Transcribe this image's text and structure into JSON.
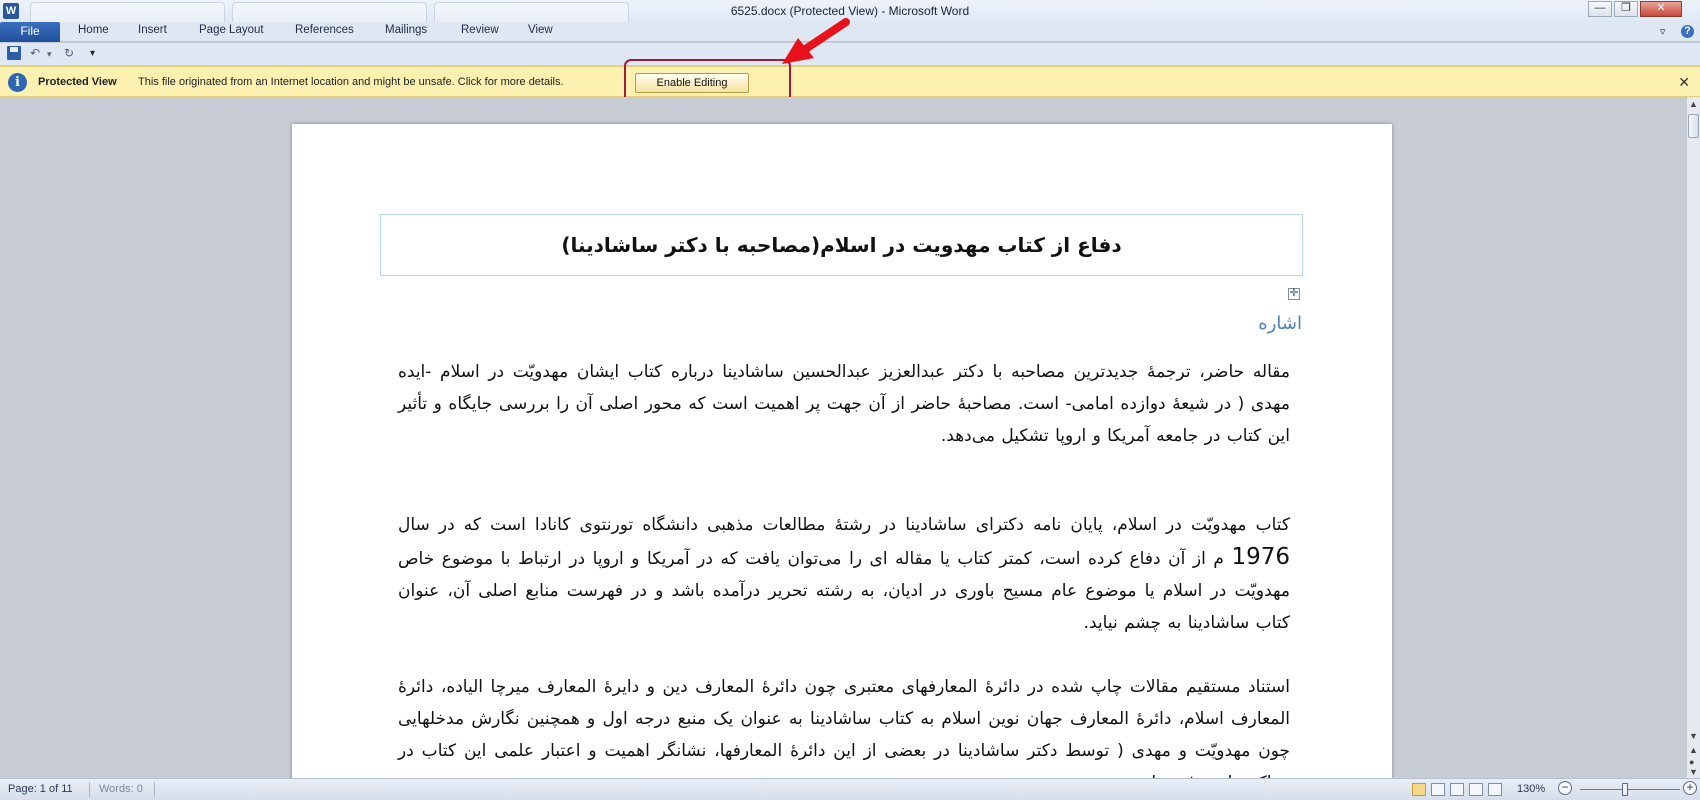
{
  "titlebar": {
    "title": "6525.docx (Protected View)  -  Microsoft Word",
    "app_icon_text": "W",
    "minimize": "—",
    "restore": "❐",
    "close": "✕"
  },
  "ribbon": {
    "file": "File",
    "tabs": [
      "Home",
      "Insert",
      "Page Layout",
      "References",
      "Mailings",
      "Review",
      "View"
    ],
    "minimize_ribbon": "▿",
    "help": "?"
  },
  "qat": {
    "undo": "↶",
    "undo_dropdown": "▾",
    "redo": "↻",
    "customize": "▾"
  },
  "protected_view": {
    "title": "Protected View",
    "message": "This file originated from an Internet location and might be unsafe. Click for more details.",
    "enable_button": "Enable Editing",
    "close": "✕",
    "icon": "i"
  },
  "document": {
    "title": "دفاع از کتاب مهدویت در اسلام(مصاحبه با دکتر ساشادینا)",
    "heading": "اشاره",
    "table_handle": "✛",
    "paragraphs": [
      {
        "before": "مقاله حاضر، ترجمهٔ جدیدترین مصاحبه با دکتر عبدالعزیز عبدالحسین ساشادینا درباره کتاب ایشان مهدویّت در اسلام -ایده مهدی ( در شیعهٔ دوازده امامی- است. مصاحبهٔ حاضر از آن جهت پر اهمیت است که محور اصلی آن را بررسی جایگاه و تأثیر این کتاب در جامعه آمریکا و اروپا تشکیل می‌دهد.",
        "big": "",
        "after": ""
      },
      {
        "before": "کتاب مهدویّت در اسلام، پایان نامه دکترای ساشادینا در رشتهٔ مطالعات مذهبی دانشگاه تورنتوی کانادا است که در سال ",
        "big": "1976",
        "after": " م از آن دفاع کرده است، کمتر کتاب یا مقاله ای را می‌توان یافت که در آمریکا و اروپا در ارتباط با موضوع خاص مهدویّت در اسلام یا موضوع عام مسیح باوری در ادیان، به رشته تحریر درآمده باشد و در فهرست منابع اصلی آن، عنوان کتاب ساشادینا به چشم نیاید."
      },
      {
        "before": "استناد مستقیم مقالات چاپ شده در دائرهٔ المعارفهای معتبری چون دائرهٔ المعارف دین و دایرهٔ المعارف میرچا الیاده، دائرهٔ المعارف اسلام، دائرهٔ المعارف جهان نوین اسلام به کتاب ساشادینا به عنوان یک منبع درجه اول و همچنین نگارش مدخلهایی چون مهدویّت و مهدی ( توسط دکتر ساشادینا در بعضی از این دائرهٔ المعارفها، نشانگر اهمیت و اعتبار علمی این کتاب در مراکز علمی غرب است.",
        "big": "",
        "after": ""
      }
    ]
  },
  "statusbar": {
    "page": "Page: 1 of 11",
    "words": "Words: 0",
    "zoom": "130%",
    "zoom_out": "−",
    "zoom_in": "+"
  },
  "scrollbar": {
    "up": "▲",
    "down": "▼",
    "prev_page": "▲",
    "select_browse": "●",
    "next_page": "▼"
  },
  "colors": {
    "message_bar": "#fcf1b0",
    "highlight_box": "#a31a3a",
    "arrow": "#e8101a",
    "heading": "#4f81bd",
    "file_tab": "#2b579a"
  }
}
